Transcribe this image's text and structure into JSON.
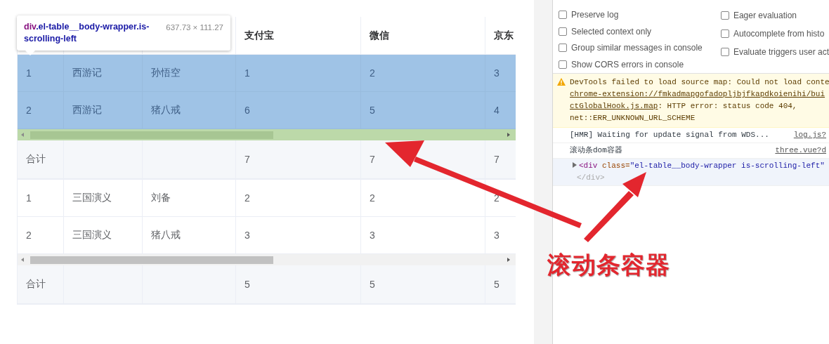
{
  "inspect_tooltip": {
    "tag": "div",
    "classes": ".el-table__body-wrapper.is-scrolling-left",
    "size": "637.73 × 111.27"
  },
  "tables": [
    {
      "header": [
        "支付宝",
        "微信",
        "京东"
      ],
      "rows": [
        [
          "1",
          "西游记",
          "孙悟空",
          "1",
          "2",
          "3"
        ],
        [
          "2",
          "西游记",
          "猪八戒",
          "6",
          "5",
          "4"
        ]
      ],
      "body_highlighted": true,
      "footer": {
        "label": "合计",
        "values": [
          "7",
          "7",
          "7"
        ]
      }
    },
    {
      "rows": [
        [
          "1",
          "三国演义",
          "刘备",
          "2",
          "2",
          "2"
        ],
        [
          "2",
          "三国演义",
          "猪八戒",
          "3",
          "3",
          "3"
        ]
      ],
      "body_highlighted": false,
      "footer": {
        "label": "合计",
        "values": [
          "5",
          "5",
          "5"
        ]
      }
    }
  ],
  "devtools": {
    "settings": [
      [
        {
          "label": "Preserve log",
          "checked": false
        },
        {
          "label": "Selected context only",
          "checked": false
        },
        {
          "label": "Group similar messages in console",
          "checked": false
        },
        {
          "label": "Show CORS errors in console",
          "checked": false
        }
      ],
      [
        {
          "label": "Eager evaluation",
          "checked": false
        },
        {
          "label": "Autocomplete from histo",
          "checked": false
        },
        {
          "label": "Evaluate triggers user act",
          "checked": false
        }
      ]
    ],
    "messages": [
      {
        "kind": "warning",
        "lines": [
          {
            "text": "DevTools failed to load source map: Could not load conte"
          },
          {
            "link": "chrome-extension://fmkadmapgofadopljbjfkapdkoienihi/bui"
          },
          {
            "link": "ctGlobalHook.js.map",
            "text": ": HTTP error: status code 404,"
          },
          {
            "text": "net::ERR_UNKNOWN_URL_SCHEME"
          }
        ]
      },
      {
        "kind": "log",
        "text": "[HMR] Waiting for update signal from WDS...",
        "source": "log.js?"
      },
      {
        "kind": "log",
        "text": "滚动条dom容器",
        "source": "three.vue?d"
      },
      {
        "kind": "element",
        "tag": "<div",
        "attr": "class=",
        "value": "\"el-table__body-wrapper is-scrolling-left\"",
        "close": "</div>"
      }
    ]
  },
  "annotation": {
    "label": "滚动条容器"
  }
}
